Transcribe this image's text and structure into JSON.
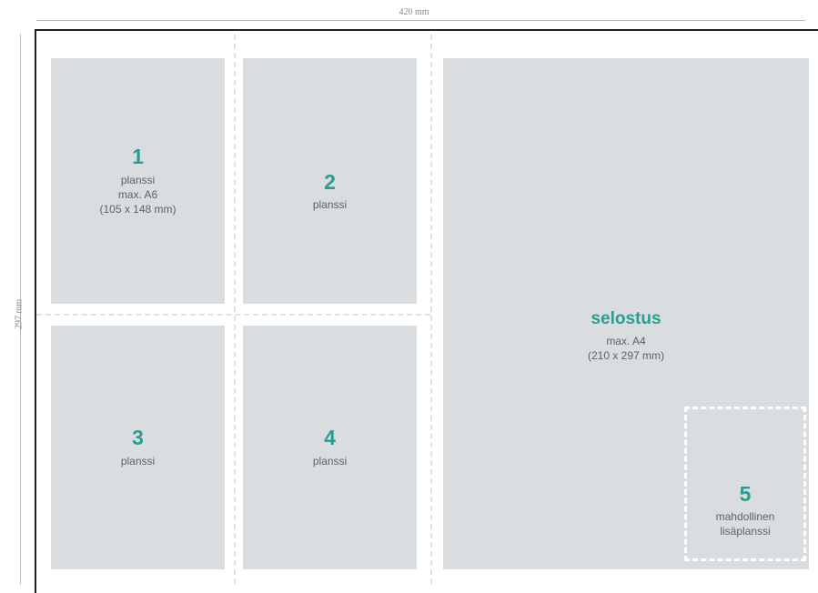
{
  "dimensions": {
    "width_label": "420 mm",
    "height_label": "297 mm"
  },
  "panels": [
    {
      "number": "1",
      "lines": [
        "planssi",
        "max. A6",
        "(105 x 148 mm)"
      ]
    },
    {
      "number": "2",
      "lines": [
        "planssi"
      ]
    },
    {
      "number": "3",
      "lines": [
        "planssi"
      ]
    },
    {
      "number": "4",
      "lines": [
        "planssi"
      ]
    }
  ],
  "selostus": {
    "title": "selostus",
    "lines": [
      "max. A4",
      "(210 x 297 mm)"
    ]
  },
  "extra_panel": {
    "number": "5",
    "lines": [
      "mahdollinen",
      "lisäplanssi"
    ]
  }
}
